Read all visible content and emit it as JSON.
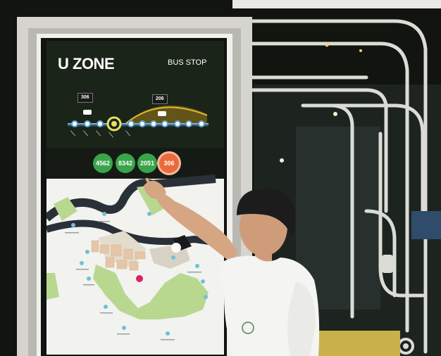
{
  "kiosk": {
    "brand": "U ZONE",
    "brand_subtitle": "",
    "title": "BUS STOP"
  },
  "route_diagram": {
    "bus_tags": [
      "306",
      "206"
    ]
  },
  "bus_routes": [
    {
      "number": "4562",
      "color": "#3aa44a",
      "selected": false
    },
    {
      "number": "8342",
      "color": "#3aa44a",
      "selected": false
    },
    {
      "number": "2051",
      "color": "#3aa44a",
      "selected": false
    },
    {
      "number": "306",
      "color": "#ec6a3a",
      "selected": true
    }
  ],
  "colors": {
    "screen_background": "#1b2418",
    "route_green": "#3aa44a",
    "route_orange": "#ec6a3a",
    "map_water": "#2a3038",
    "map_park": "#b8d890",
    "accent_yellow": "#e0b830"
  }
}
